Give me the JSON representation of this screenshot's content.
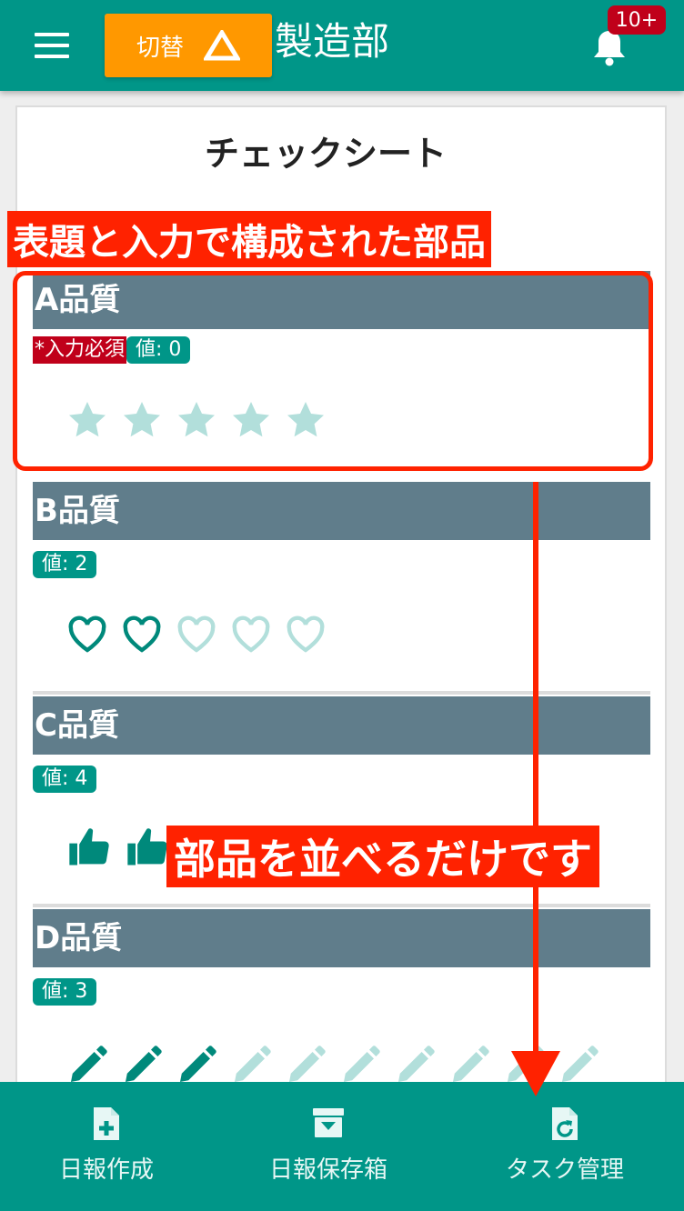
{
  "header": {
    "switch_label": "切替",
    "title": "製造部",
    "notification_count": "10+"
  },
  "sheet": {
    "title": "チェックシート",
    "items": [
      {
        "title": "A品質",
        "required_label": "*入力必須",
        "value_label": "値: 0",
        "icon": "star-icon",
        "value": 0,
        "max": 5
      },
      {
        "title": "B品質",
        "value_label": "値: 2",
        "icon": "heart-icon",
        "value": 2,
        "max": 5
      },
      {
        "title": "C品質",
        "value_label": "値: 4",
        "icon": "thumbs-up-icon",
        "value": 4,
        "max": 5
      },
      {
        "title": "D品質",
        "value_label": "値: 3",
        "icon": "pencil-icon",
        "value": 3,
        "max": 10
      }
    ]
  },
  "annotations": {
    "component_label": "表題と入力で構成された部品",
    "arrange_label": "部品を並べるだけです"
  },
  "bottom_nav": {
    "items": [
      {
        "label": "日報作成",
        "icon": "file-plus-icon"
      },
      {
        "label": "日報保存箱",
        "icon": "archive-box-icon"
      },
      {
        "label": "タスク管理",
        "icon": "file-refresh-icon"
      }
    ]
  },
  "colors": {
    "primary": "#009688",
    "accent": "#ff9800",
    "section_header": "#607d8b",
    "required": "#c0001a",
    "annotation": "#ff2200",
    "icon_inactive": "#b2dfdb"
  }
}
